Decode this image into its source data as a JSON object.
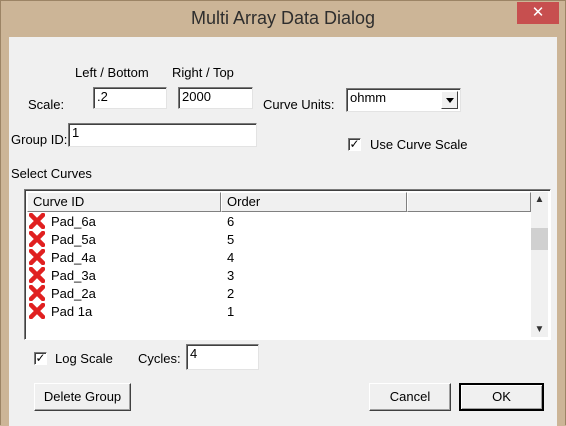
{
  "window": {
    "title": "Multi Array Data Dialog",
    "close_glyph": "✕"
  },
  "scale": {
    "left_bottom_label": "Left / Bottom",
    "right_top_label": "Right / Top",
    "label": "Scale:",
    "left_value": ".2",
    "right_value": "2000"
  },
  "curve_units": {
    "label": "Curve Units:",
    "selected": "ohmm"
  },
  "group_id": {
    "label": "Group ID:",
    "value": "1"
  },
  "use_curve_scale": {
    "label": "Use Curve Scale",
    "checked": true,
    "mark": "✓"
  },
  "select_curves": {
    "label": "Select Curves",
    "columns": [
      "Curve ID",
      "Order"
    ],
    "rows": [
      {
        "curve_id": "Pad_6a",
        "order": "6"
      },
      {
        "curve_id": "Pad_5a",
        "order": "5"
      },
      {
        "curve_id": "Pad_4a",
        "order": "4"
      },
      {
        "curve_id": "Pad_3a",
        "order": "3"
      },
      {
        "curve_id": "Pad_2a",
        "order": "2"
      },
      {
        "curve_id": "Pad 1a",
        "order": "1"
      }
    ],
    "curve_icon": "red-x-curve-icon",
    "curve_icon_color": "#e02020"
  },
  "log_scale": {
    "label": "Log Scale",
    "checked": true,
    "mark": "✓"
  },
  "cycles": {
    "label": "Cycles:",
    "value": "4"
  },
  "buttons": {
    "delete_group": "Delete Group",
    "cancel": "Cancel",
    "ok": "OK"
  }
}
